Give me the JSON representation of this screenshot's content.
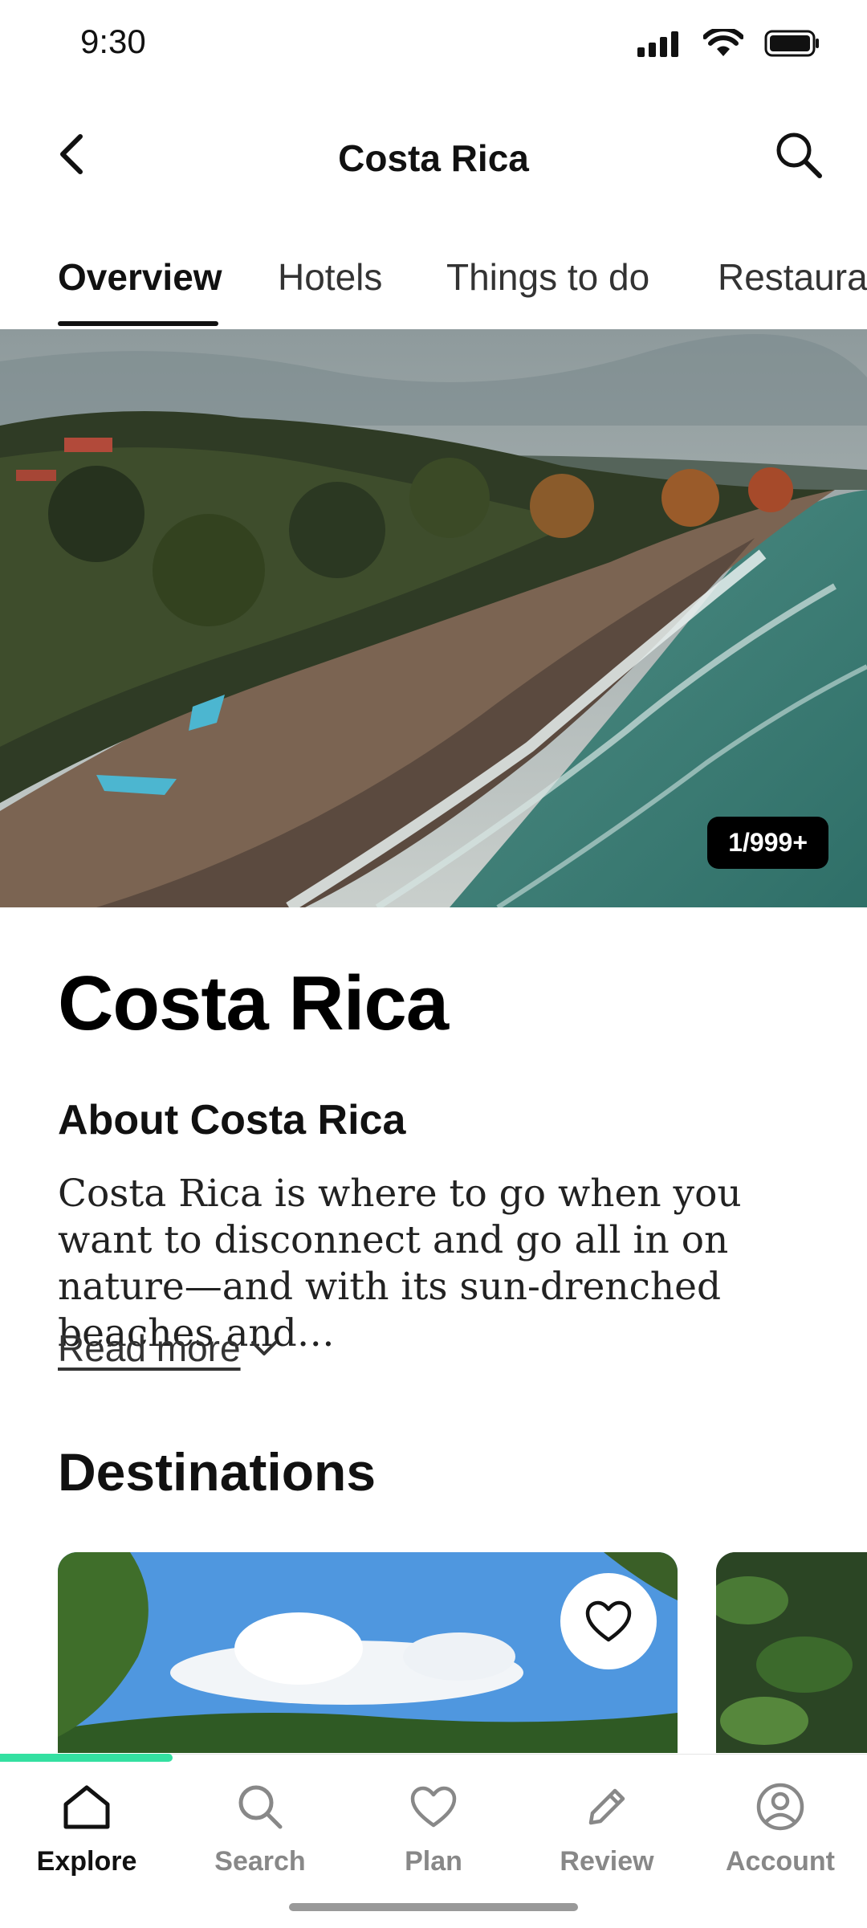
{
  "status_bar": {
    "time": "9:30"
  },
  "header": {
    "title": "Costa Rica"
  },
  "tabs": [
    {
      "label": "Overview"
    },
    {
      "label": "Hotels"
    },
    {
      "label": "Things to do"
    },
    {
      "label": "Restaurants"
    }
  ],
  "hero": {
    "photo_counter": "1/999+"
  },
  "place": {
    "title": "Costa Rica",
    "about_heading": "About Costa Rica",
    "about_text": "Costa Rica is where to go when you want to disconnect and go all in on nature—and with its sun-drenched beaches and…",
    "read_more": "Read more"
  },
  "destinations": {
    "heading": "Destinations"
  },
  "bottom_nav": [
    {
      "label": "Explore",
      "icon": "home-icon"
    },
    {
      "label": "Search",
      "icon": "search-icon"
    },
    {
      "label": "Plan",
      "icon": "heart-icon"
    },
    {
      "label": "Review",
      "icon": "pencil-icon"
    },
    {
      "label": "Account",
      "icon": "account-icon"
    }
  ],
  "colors": {
    "accent": "#34e0a1",
    "text": "#000000"
  }
}
